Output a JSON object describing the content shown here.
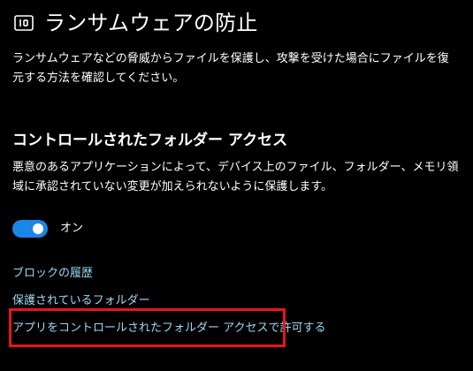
{
  "header": {
    "icon": "ransomware-protection-icon",
    "title": "ランサムウェアの防止"
  },
  "intro": {
    "text": "ランサムウェアなどの脅威からファイルを保護し、攻撃を受けた場合にファイルを復元する方法を確認してください。"
  },
  "cfa": {
    "title": "コントロールされたフォルダー アクセス",
    "description": "悪意のあるアプリケーションによって、デバイス上のファイル、フォルダー、メモリ領域に承認されていない変更が加えられないように保護します。",
    "toggle": {
      "state_label": "オン",
      "on": true,
      "accent_color": "#1a86e8"
    }
  },
  "links": {
    "block_history": "ブロックの履歴",
    "protected_folders": "保護されているフォルダー",
    "allow_app": "アプリをコントロールされたフォルダー アクセスで許可する"
  },
  "colors": {
    "background": "#000000",
    "link": "#9fd8f2",
    "highlight": "#e5161b"
  }
}
